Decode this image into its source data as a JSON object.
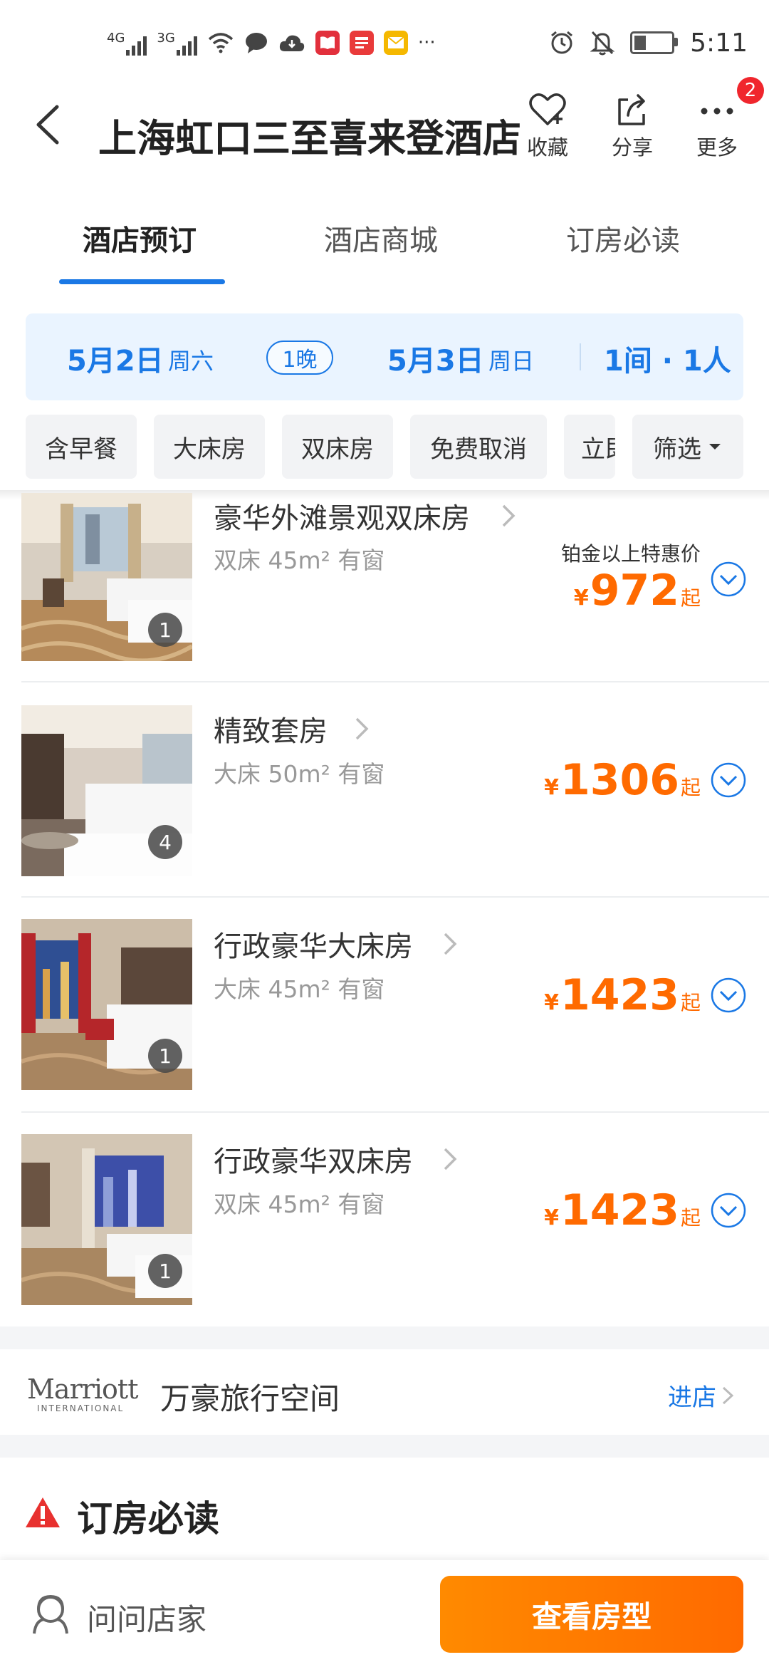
{
  "status_bar": {
    "signal_1": "4G",
    "signal_2": "3G",
    "more_dots": "···",
    "time": "5:11",
    "icons": [
      "wifi-icon",
      "message-icon",
      "cloud-icon",
      "reader-app-icon",
      "news-app-icon",
      "mail-app-icon",
      "alarm-icon",
      "mute-icon",
      "battery-icon"
    ]
  },
  "header": {
    "title": "上海虹口三至喜来登酒店",
    "actions": [
      {
        "label": "收藏",
        "icon": "heart-icon"
      },
      {
        "label": "分享",
        "icon": "share-icon"
      },
      {
        "label": "更多",
        "icon": "more-icon"
      }
    ],
    "badge": "2"
  },
  "tabs": [
    {
      "label": "酒店预订",
      "active": true
    },
    {
      "label": "酒店商城",
      "active": false
    },
    {
      "label": "订房必读",
      "active": false
    }
  ],
  "date_bar": {
    "checkin_date": "5月2日",
    "checkin_weekday": "周六",
    "nights": "1晚",
    "checkout_date": "5月3日",
    "checkout_weekday": "周日",
    "occupancy": "1间 · 1人"
  },
  "filters": [
    "含早餐",
    "大床房",
    "双床房",
    "免费取消",
    "立即确认"
  ],
  "filter_button": "筛选",
  "rooms": [
    {
      "name": "豪华外滩景观双床房",
      "meta": "双床 45m² 有窗",
      "promo": "铂金以上特惠价",
      "currency": "¥",
      "price": "972",
      "suffix": "起",
      "photo_count": "1"
    },
    {
      "name": "精致套房",
      "meta": "大床 50m² 有窗",
      "promo": "",
      "currency": "¥",
      "price": "1306",
      "suffix": "起",
      "photo_count": "4"
    },
    {
      "name": "行政豪华大床房",
      "meta": "大床 45m² 有窗",
      "promo": "",
      "currency": "¥",
      "price": "1423",
      "suffix": "起",
      "photo_count": "1"
    },
    {
      "name": "行政豪华双床房",
      "meta": "双床 45m² 有窗",
      "promo": "",
      "currency": "¥",
      "price": "1423",
      "suffix": "起",
      "photo_count": "1"
    }
  ],
  "brand": {
    "logo_text": "Marriott",
    "logo_sub": "INTERNATIONAL",
    "name": "万豪旅行空间",
    "enter": "进店"
  },
  "notice": {
    "title": "订房必读"
  },
  "bottom": {
    "ask": "问问店家",
    "cta": "查看房型"
  },
  "colors": {
    "accent": "#1a78e5",
    "price": "#ff6a00",
    "cta_start": "#ff8a00",
    "cta_end": "#ff6a00",
    "badge": "#f0262d",
    "date_bar_bg": "#eaf4ff"
  }
}
